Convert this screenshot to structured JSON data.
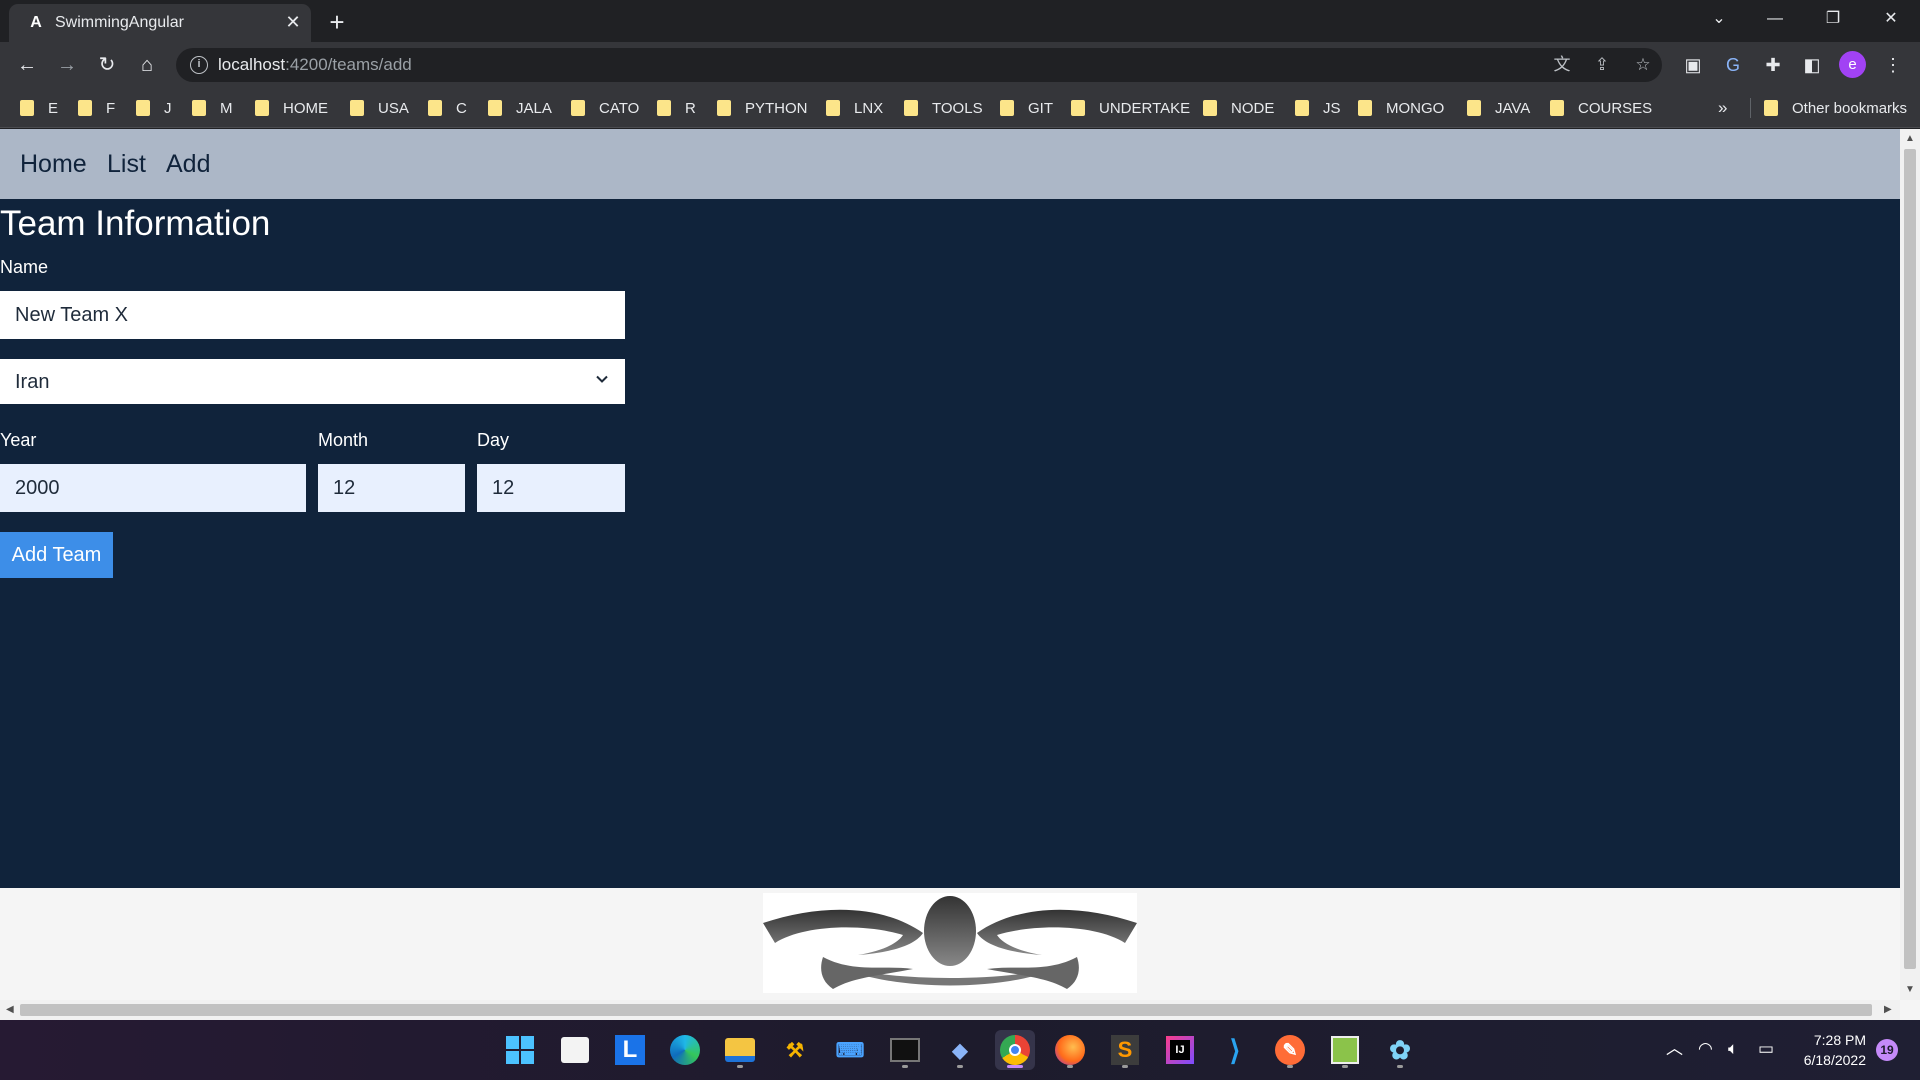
{
  "browser": {
    "tab_title": "SwimmingAngular",
    "url_host": "localhost",
    "url_path": ":4200/teams/add",
    "bookmarks": [
      "E",
      "F",
      "J",
      "M",
      "HOME",
      "USA",
      "C",
      "JALA",
      "CATO",
      "R",
      "PYTHON",
      "LNX",
      "TOOLS",
      "GIT",
      "UNDERTAKE",
      "NODE",
      "JS",
      "MONGO",
      "JAVA",
      "COURSES"
    ],
    "bookmarks_more": "»",
    "other_bookmarks": "Other bookmarks",
    "profile_initial": "e"
  },
  "app": {
    "nav": [
      "Home",
      "List",
      "Add"
    ],
    "title": "Team Information",
    "form": {
      "name_label": "Name",
      "name_value": "New Team X",
      "country_value": "Iran",
      "year_label": "Year",
      "year_value": "2000",
      "month_label": "Month",
      "month_value": "12",
      "day_label": "Day",
      "day_value": "12",
      "submit_label": "Add Team"
    }
  },
  "taskbar": {
    "time": "7:28 PM",
    "date": "6/18/2022",
    "notifications": "19"
  },
  "colors": {
    "nav_bg": "#acb7c7",
    "content_bg": "#10233b",
    "button_bg": "#3d8ee8",
    "autofill_bg": "#e8f0fe"
  }
}
